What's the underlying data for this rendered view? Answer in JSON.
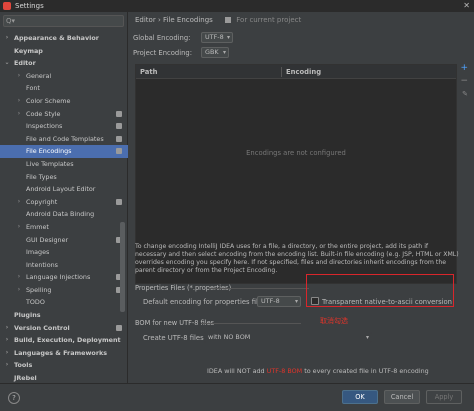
{
  "window": {
    "title": "Settings",
    "close": "✕"
  },
  "search": {
    "placeholder": "Q▾"
  },
  "tree": [
    {
      "label": "Appearance & Behavior",
      "level": 0,
      "arrow": "›",
      "bold": true
    },
    {
      "label": "Keymap",
      "level": 0,
      "bold": true
    },
    {
      "label": "Editor",
      "level": 0,
      "arrow": "⌄",
      "bold": true
    },
    {
      "label": "General",
      "level": 1,
      "arrow": "›"
    },
    {
      "label": "Font",
      "level": 1
    },
    {
      "label": "Color Scheme",
      "level": 1,
      "arrow": "›"
    },
    {
      "label": "Code Style",
      "level": 1,
      "arrow": "›",
      "proj": true
    },
    {
      "label": "Inspections",
      "level": 1,
      "proj": true
    },
    {
      "label": "File and Code Templates",
      "level": 1,
      "proj": true
    },
    {
      "label": "File Encodings",
      "level": 1,
      "proj": true,
      "selected": true
    },
    {
      "label": "Live Templates",
      "level": 1
    },
    {
      "label": "File Types",
      "level": 1
    },
    {
      "label": "Android Layout Editor",
      "level": 1
    },
    {
      "label": "Copyright",
      "level": 1,
      "arrow": "›",
      "proj": true
    },
    {
      "label": "Android Data Binding",
      "level": 1
    },
    {
      "label": "Emmet",
      "level": 1,
      "arrow": "›"
    },
    {
      "label": "GUI Designer",
      "level": 1,
      "proj": true
    },
    {
      "label": "Images",
      "level": 1
    },
    {
      "label": "Intentions",
      "level": 1
    },
    {
      "label": "Language Injections",
      "level": 1,
      "arrow": "›",
      "proj": true
    },
    {
      "label": "Spelling",
      "level": 1,
      "arrow": "›",
      "proj": true
    },
    {
      "label": "TODO",
      "level": 1
    },
    {
      "label": "Plugins",
      "level": 0,
      "bold": true
    },
    {
      "label": "Version Control",
      "level": 0,
      "arrow": "›",
      "bold": true,
      "proj": true
    },
    {
      "label": "Build, Execution, Deployment",
      "level": 0,
      "arrow": "›",
      "bold": true
    },
    {
      "label": "Languages & Frameworks",
      "level": 0,
      "arrow": "›",
      "bold": true
    },
    {
      "label": "Tools",
      "level": 0,
      "arrow": "›",
      "bold": true
    },
    {
      "label": "JRebel",
      "level": 0,
      "bold": true
    }
  ],
  "breadcrumb": {
    "path": "Editor  ›  File Encodings",
    "scope": "For current project"
  },
  "global_encoding": {
    "label": "Global Encoding:",
    "value": "UTF-8"
  },
  "project_encoding": {
    "label": "Project Encoding:",
    "value": "GBK"
  },
  "table": {
    "col_path": "Path",
    "col_encoding": "Encoding",
    "empty": "Encodings are not configured",
    "add": "+",
    "remove": "−",
    "edit": "✎"
  },
  "description": "To change encoding IntelliJ IDEA uses for a file, a directory, or the entire project, add its path if necessary and then select encoding from the encoding list. Built-in file encoding (e.g. JSP, HTML or XML) overrides encoding you specify here. If not specified, files and directories inherit encodings from the parent directory or from the Project Encoding.",
  "properties": {
    "section": "Properties Files (*.properties)",
    "default_label": "Default encoding for properties files:",
    "default_value": "UTF-8",
    "transparent_label": "Transparent native-to-ascii conversion"
  },
  "annotation": "取消勾选",
  "bom": {
    "section": "BOM for new UTF-8 files",
    "create_label": "Create UTF-8 files:",
    "create_value": "with NO BOM",
    "warn_prefix": "IDEA will NOT add",
    "warn_highlight": "UTF-8 BOM",
    "warn_suffix": "to every created file in UTF-8 encoding"
  },
  "footer": {
    "help": "?",
    "ok": "OK",
    "cancel": "Cancel",
    "apply": "Apply"
  },
  "colors": {
    "selection": "#4b6eaf",
    "annotation": "#d9262b",
    "accent": "#4fa3ff"
  }
}
